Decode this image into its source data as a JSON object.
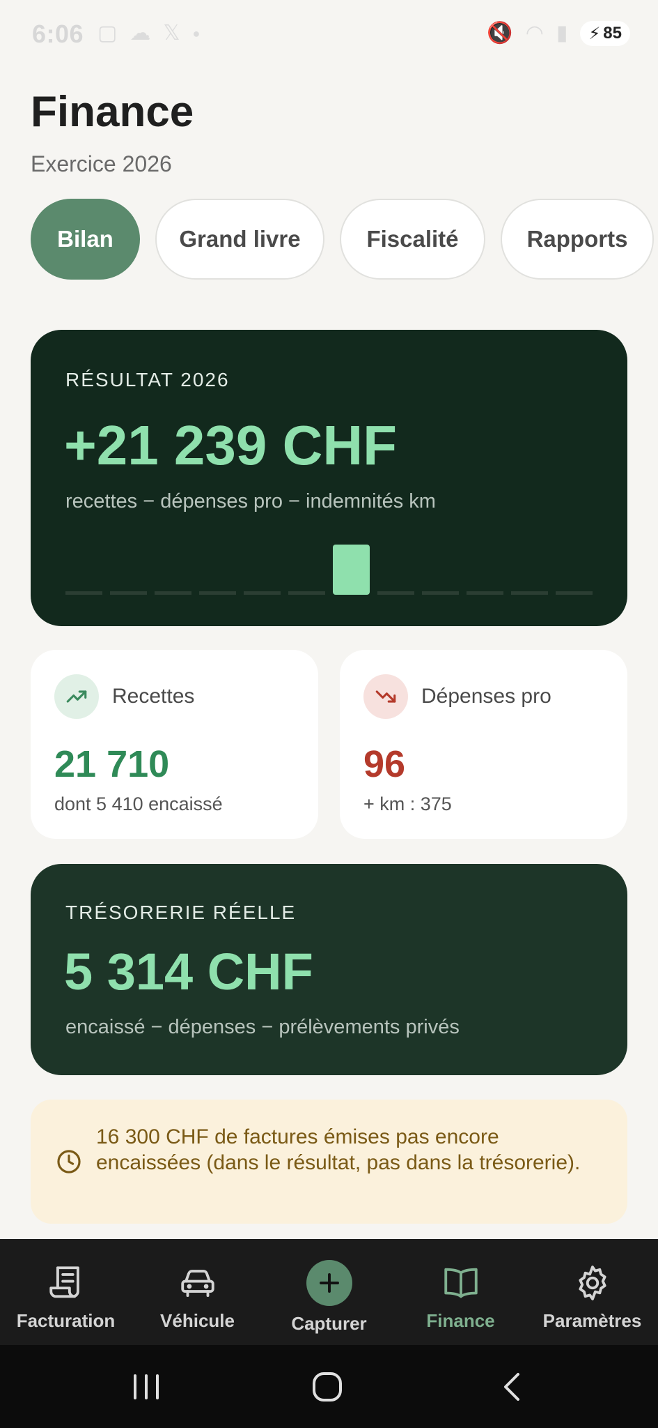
{
  "status_bar": {
    "time": "6:06",
    "battery": "85"
  },
  "header": {
    "title": "Finance",
    "subtitle": "Exercice 2026"
  },
  "tabs": [
    {
      "label": "Bilan",
      "active": true
    },
    {
      "label": "Grand livre",
      "active": false
    },
    {
      "label": "Fiscalité",
      "active": false
    },
    {
      "label": "Rapports",
      "active": false
    }
  ],
  "result_card": {
    "label": "RÉSULTAT 2026",
    "value": "+21 239 CHF",
    "note": "recettes − dépenses pro − indemnités km",
    "monthly_bars": {
      "count": 12,
      "active_index": 6,
      "active_level": 1
    }
  },
  "stats": {
    "income": {
      "label": "Recettes",
      "value": "21 710",
      "sub": "dont 5 410 encaissé",
      "color": "#2f8a57"
    },
    "expenses": {
      "label": "Dépenses pro",
      "value": "96",
      "sub": "+ km : 375",
      "color": "#b43a2b"
    }
  },
  "treasury_card": {
    "label": "TRÉSORERIE RÉELLE",
    "value": "5 314 CHF",
    "note": "encaissé − dépenses − prélèvements privés"
  },
  "banner": {
    "text": "16 300 CHF de factures émises pas encore encaissées (dans le résultat, pas dans la trésorerie)."
  },
  "bottom_nav": [
    {
      "label": "Facturation",
      "icon": "receipt-icon",
      "active": false
    },
    {
      "label": "Véhicule",
      "icon": "car-icon",
      "active": false
    },
    {
      "label": "Capturer",
      "icon": "plus-icon",
      "active": false
    },
    {
      "label": "Finance",
      "icon": "book-icon",
      "active": true
    },
    {
      "label": "Paramètres",
      "icon": "gear-icon",
      "active": false
    }
  ],
  "colors": {
    "accent": "#5b8a6d",
    "dark_card": "#12291d",
    "highlight": "#8fe0ad"
  }
}
